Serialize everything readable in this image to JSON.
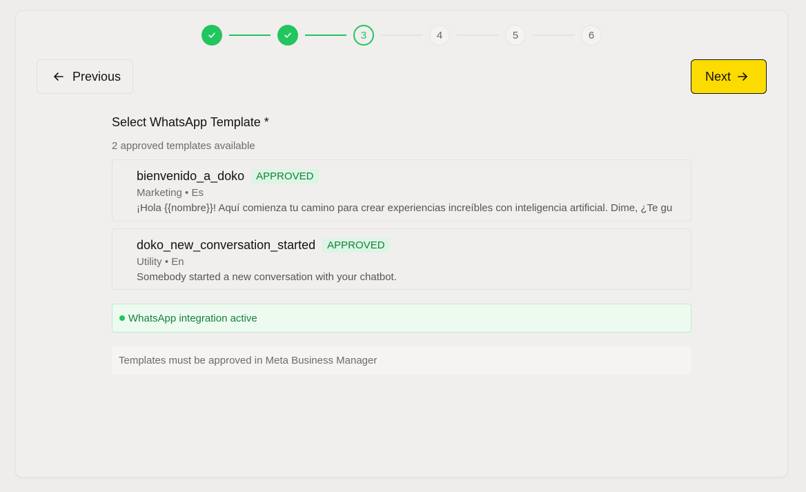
{
  "stepper": {
    "steps": [
      {
        "label": "",
        "state": "done"
      },
      {
        "label": "",
        "state": "done"
      },
      {
        "label": "3",
        "state": "current"
      },
      {
        "label": "4",
        "state": "todo"
      },
      {
        "label": "5",
        "state": "todo"
      },
      {
        "label": "6",
        "state": "todo"
      }
    ]
  },
  "nav": {
    "previous_label": "Previous",
    "next_label": "Next"
  },
  "form": {
    "title": "Select WhatsApp Template *",
    "subtitle": "2 approved templates available",
    "templates": [
      {
        "name": "bienvenido_a_doko",
        "status": "APPROVED",
        "meta": "Marketing • Es",
        "body": "¡Hola {{nombre}}! Aquí comienza tu camino para crear experiencias increíbles con inteligencia artificial. Dime, ¿Te gu"
      },
      {
        "name": "doko_new_conversation_started",
        "status": "APPROVED",
        "meta": "Utility • En",
        "body": "Somebody started a new conversation with your chatbot."
      }
    ],
    "integration_status": "WhatsApp integration active",
    "note": "Templates must be approved in Meta Business Manager"
  },
  "colors": {
    "accent_green": "#22c55e",
    "next_button": "#fcdb00"
  }
}
